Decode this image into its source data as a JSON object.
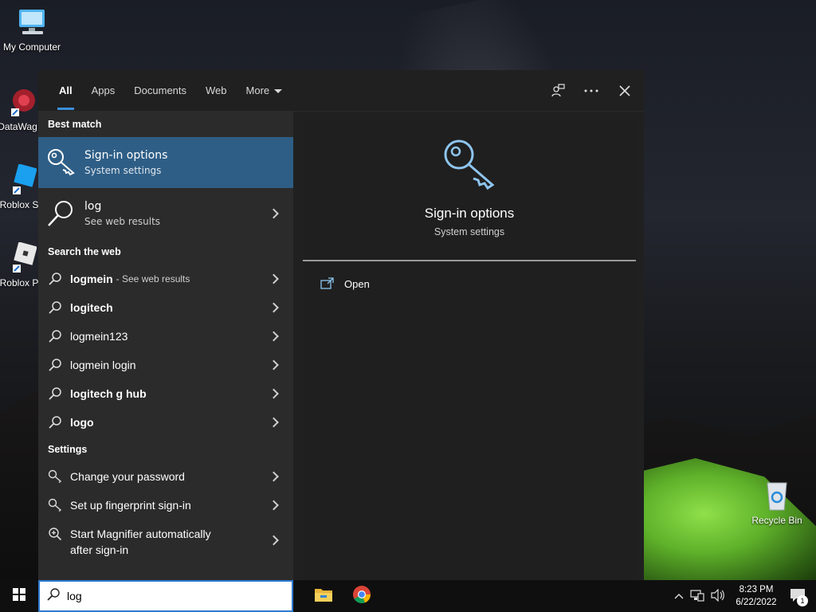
{
  "desktop": {
    "icons": [
      {
        "label": "My Computer"
      },
      {
        "label": "DataWag"
      },
      {
        "label": "Roblox S"
      },
      {
        "label": "Roblox P"
      },
      {
        "label": "Recycle Bin"
      }
    ]
  },
  "start": {
    "tabs": [
      {
        "label": "All",
        "active": true
      },
      {
        "label": "Apps"
      },
      {
        "label": "Documents"
      },
      {
        "label": "Web"
      },
      {
        "label": "More"
      }
    ],
    "best_match_heading": "Best match",
    "best_match": {
      "title": "Sign-in options",
      "subtitle": "System settings"
    },
    "web_result": {
      "title": "log",
      "subtitle": "See web results"
    },
    "search_web_heading": "Search the web",
    "web_suggestions": [
      {
        "bold": "logmein",
        "suffix": " - See web results"
      },
      {
        "bold": "logitech",
        "suffix": ""
      },
      {
        "bold": "logmein123",
        "suffix": ""
      },
      {
        "bold": "logmein login",
        "suffix": ""
      },
      {
        "bold": "logitech g hub",
        "suffix": ""
      },
      {
        "bold": "logo",
        "suffix": ""
      }
    ],
    "settings_heading": "Settings",
    "settings_items": [
      {
        "label": "Change your password"
      },
      {
        "label": "Set up fingerprint sign-in"
      },
      {
        "label": "Start Magnifier automatically",
        "label2": "after sign-in"
      }
    ],
    "detail": {
      "title": "Sign-in options",
      "subtitle": "System settings",
      "open_label": "Open"
    }
  },
  "taskbar": {
    "search_value": "log",
    "time": "8:23 PM",
    "date": "6/22/2022",
    "notification_count": "1"
  },
  "colors": {
    "accent": "#3b8fd9",
    "selected": "#2e5e86",
    "pane": "#2b2b2b"
  }
}
